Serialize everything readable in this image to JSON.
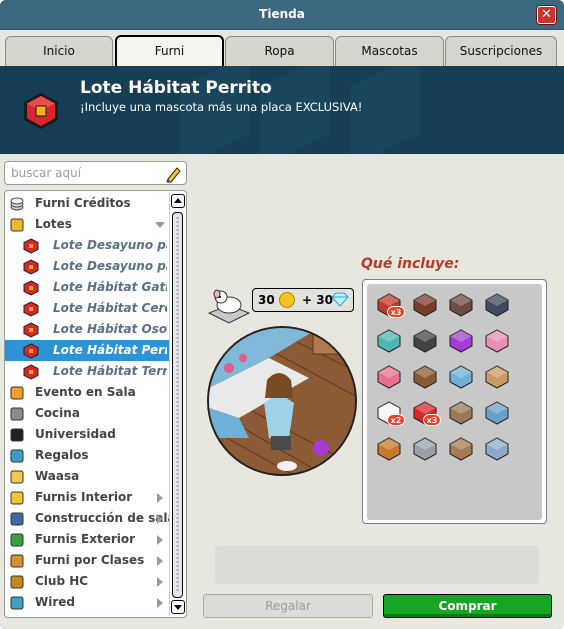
{
  "window": {
    "title": "Tienda",
    "close_label": "✕"
  },
  "tabs": [
    {
      "label": "Inicio",
      "active": false
    },
    {
      "label": "Furni",
      "active": true
    },
    {
      "label": "Ropa",
      "active": false
    },
    {
      "label": "Mascotas",
      "active": false
    },
    {
      "label": "Suscripciones",
      "active": false
    }
  ],
  "banner": {
    "title": "Lote Hábitat Perrito",
    "subtitle": "¡Incluye una mascota más una placa EXCLUSIVA!"
  },
  "search": {
    "placeholder": "buscar aquí",
    "value": ""
  },
  "tree": [
    {
      "label": "Furni Créditos",
      "level": 0,
      "icon": "coins-icon"
    },
    {
      "label": "Lotes",
      "level": 0,
      "icon": "lotes-icon",
      "expanded": true
    },
    {
      "label": "Lote Desayuno para",
      "level": 1,
      "icon": "bundle-icon"
    },
    {
      "label": "Lote Desayuno para",
      "level": 1,
      "icon": "bundle-icon"
    },
    {
      "label": "Lote Hábitat Gatito",
      "level": 1,
      "icon": "bundle-icon"
    },
    {
      "label": "Lote Hábitat Cerdito",
      "level": 1,
      "icon": "bundle-icon"
    },
    {
      "label": "Lote Hábitat Oso Po",
      "level": 1,
      "icon": "bundle-icon"
    },
    {
      "label": "Lote Hábitat Perrito",
      "level": 1,
      "icon": "bundle-icon",
      "selected": true
    },
    {
      "label": "Lote Hábitat Terrier",
      "level": 1,
      "icon": "bundle-icon"
    },
    {
      "label": "Evento en Sala",
      "level": 0,
      "icon": "event-icon"
    },
    {
      "label": "Cocina",
      "level": 0,
      "icon": "kitchen-icon"
    },
    {
      "label": "Universidad",
      "level": 0,
      "icon": "graduation-cap-icon"
    },
    {
      "label": "Regalos",
      "level": 0,
      "icon": "gift-icon"
    },
    {
      "label": "Waasa",
      "level": 0,
      "icon": "waasa-icon"
    },
    {
      "label": "Furnis Interior",
      "level": 0,
      "icon": "interior-icon",
      "has_children": true
    },
    {
      "label": "Construcción de sala",
      "level": 0,
      "icon": "construction-icon",
      "has_children": true
    },
    {
      "label": "Furnis Exterior",
      "level": 0,
      "icon": "plant-icon",
      "has_children": true
    },
    {
      "label": "Furni por Clases",
      "level": 0,
      "icon": "classes-icon",
      "has_children": true
    },
    {
      "label": "Club HC",
      "level": 0,
      "icon": "club-hc-icon",
      "has_children": true
    },
    {
      "label": "Wired",
      "level": 0,
      "icon": "wired-icon",
      "has_children": true
    }
  ],
  "price": {
    "credits": "30",
    "plus_diamonds": "+ 30"
  },
  "includes": {
    "title": "Qué incluye:",
    "items": [
      {
        "icon": "necklace-icon",
        "badge": "x3"
      },
      {
        "icon": "fireplace-icon",
        "badge": ""
      },
      {
        "icon": "coat-rack-icon",
        "badge": ""
      },
      {
        "icon": "window-icon",
        "badge": ""
      },
      {
        "icon": "cushion-icon",
        "badge": ""
      },
      {
        "icon": "dark-rug-icon",
        "badge": ""
      },
      {
        "icon": "purple-flower-icon",
        "badge": ""
      },
      {
        "icon": "pink-chair-icon",
        "badge": ""
      },
      {
        "icon": "pink-sofa-icon",
        "badge": ""
      },
      {
        "icon": "wood-chair-icon",
        "badge": ""
      },
      {
        "icon": "blue-bed-icon",
        "badge": ""
      },
      {
        "icon": "desk-icon",
        "badge": ""
      },
      {
        "icon": "white-rug-icon",
        "badge": "x2"
      },
      {
        "icon": "red-rug-icon",
        "badge": "x3"
      },
      {
        "icon": "wardrobe-icon",
        "badge": ""
      },
      {
        "icon": "lamp-icon",
        "badge": ""
      },
      {
        "icon": "pet-dog-icon",
        "badge": ""
      },
      {
        "icon": "laptop-icon",
        "badge": ""
      },
      {
        "icon": "nightstand-icon",
        "badge": ""
      },
      {
        "icon": "picture-frame-icon",
        "badge": ""
      }
    ]
  },
  "buttons": {
    "gift": "Regalar",
    "buy": "Comprar"
  },
  "colors": {
    "accent_green": "#18a524",
    "selected_blue": "#2c93d7",
    "includes_title": "#b23d2a",
    "banner_bg": "#163e54"
  }
}
